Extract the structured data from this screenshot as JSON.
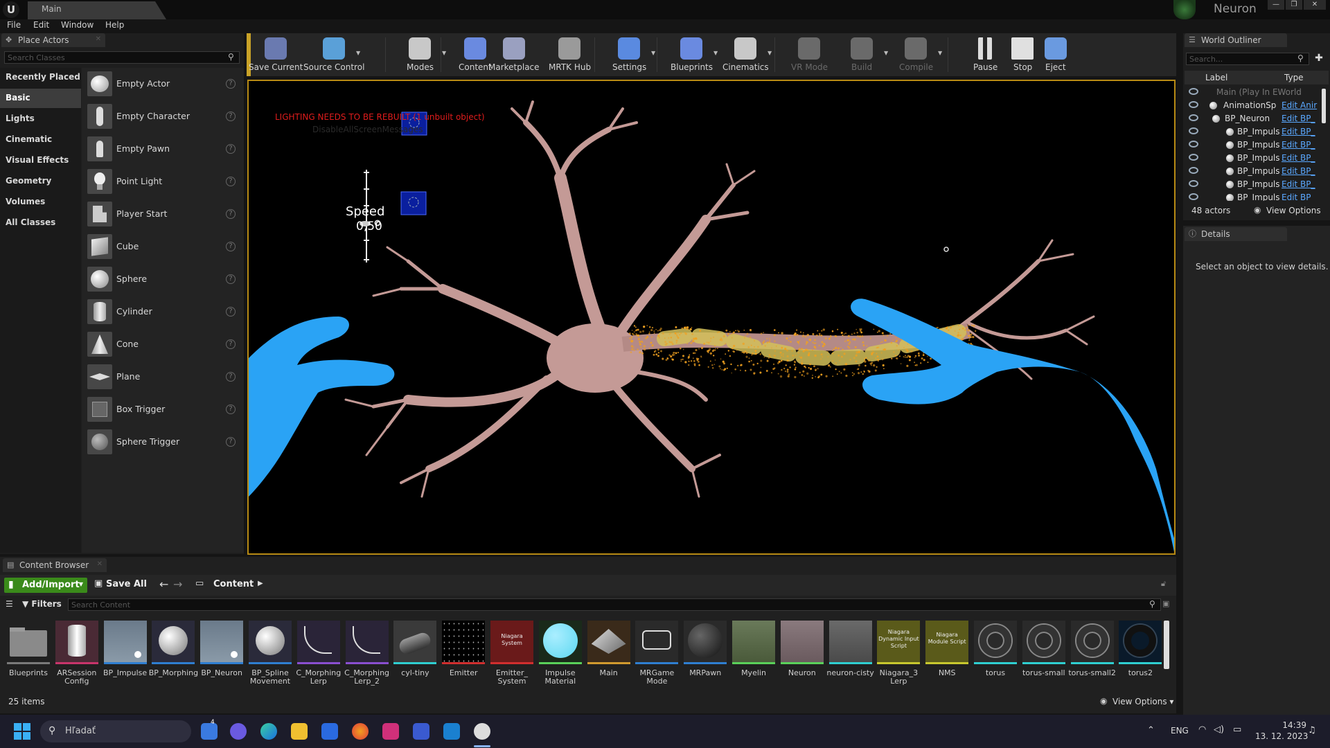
{
  "window": {
    "doc_tab": "Main",
    "project_name": "Neuron"
  },
  "menu": [
    "File",
    "Edit",
    "Window",
    "Help"
  ],
  "place_actors": {
    "tab_title": "Place Actors",
    "search_placeholder": "Search Classes",
    "categories": [
      "Recently Placed",
      "Basic",
      "Lights",
      "Cinematic",
      "Visual Effects",
      "Geometry",
      "Volumes",
      "All Classes"
    ],
    "selected_category": "Basic",
    "actors": [
      "Empty Actor",
      "Empty Character",
      "Empty Pawn",
      "Point Light",
      "Player Start",
      "Cube",
      "Sphere",
      "Cylinder",
      "Cone",
      "Plane",
      "Box Trigger",
      "Sphere Trigger"
    ]
  },
  "toolbar": {
    "buttons": [
      {
        "label": "Save Current",
        "icon": "save-icon"
      },
      {
        "label": "Source Control",
        "icon": "source-control-icon"
      },
      {
        "label": "Modes",
        "icon": "modes-icon"
      },
      {
        "label": "Content",
        "icon": "content-icon"
      },
      {
        "label": "Marketplace",
        "icon": "marketplace-icon"
      },
      {
        "label": "MRTK Hub",
        "icon": "mrtk-hub-icon"
      },
      {
        "label": "Settings",
        "icon": "settings-icon"
      },
      {
        "label": "Blueprints",
        "icon": "blueprints-icon"
      },
      {
        "label": "Cinematics",
        "icon": "cinematics-icon"
      },
      {
        "label": "VR Mode",
        "icon": "vr-mode-icon"
      },
      {
        "label": "Build",
        "icon": "build-icon"
      },
      {
        "label": "Compile",
        "icon": "compile-icon"
      },
      {
        "label": "Pause",
        "icon": "pause-icon"
      },
      {
        "label": "Stop",
        "icon": "stop-icon"
      },
      {
        "label": "Eject",
        "icon": "eject-icon"
      }
    ]
  },
  "viewport": {
    "warning": "LIGHTING NEEDS TO BE REBUILT (1 unbuilt object)",
    "warning_sub": "DisableAllScreenMessages",
    "speed_label": "Speed",
    "speed_value": "0,50"
  },
  "world_outliner": {
    "tab_title": "World Outliner",
    "search_placeholder": "Search...",
    "col_label": "Label",
    "col_type": "Type",
    "rows": [
      {
        "label": "Main (Play In EWorld",
        "type": ""
      },
      {
        "label": "AnimationSp",
        "type": "Edit Anir"
      },
      {
        "label": "BP_Neuron",
        "type": "Edit BP_"
      },
      {
        "label": "BP_Impuls",
        "type": "Edit BP_"
      },
      {
        "label": "BP_Impuls",
        "type": "Edit BP_"
      },
      {
        "label": "BP_Impuls",
        "type": "Edit BP_"
      },
      {
        "label": "BP_Impuls",
        "type": "Edit BP_"
      },
      {
        "label": "BP_Impuls",
        "type": "Edit BP_"
      },
      {
        "label": "BP_Impuls",
        "type": "Edit BP_"
      }
    ],
    "actor_count": "48 actors",
    "view_options": "View Options"
  },
  "details": {
    "tab_title": "Details",
    "empty_message": "Select an object to view details."
  },
  "content_browser": {
    "tab_title": "Content Browser",
    "add_import": "Add/Import",
    "save_all": "Save All",
    "path": "Content",
    "filters": "Filters",
    "search_placeholder": "Search Content",
    "item_count": "25 items",
    "view_options": "View Options",
    "assets": [
      {
        "name": "Blueprints",
        "kind": "folder",
        "color": "#7a7a7a"
      },
      {
        "name": "ARSession Config",
        "kind": "config",
        "color": "#c8356b"
      },
      {
        "name": "BP_Impulse",
        "kind": "bp",
        "color": "#2f7fd1"
      },
      {
        "name": "BP_Morphing",
        "kind": "bp-sphere",
        "color": "#2f7fd1"
      },
      {
        "name": "BP_Neuron",
        "kind": "bp",
        "color": "#2f7fd1"
      },
      {
        "name": "BP_Spline Movement",
        "kind": "bp-sphere",
        "color": "#2f7fd1"
      },
      {
        "name": "C_Morphing Lerp",
        "kind": "curve",
        "color": "#8a4fd1"
      },
      {
        "name": "C_Morphing Lerp_2",
        "kind": "curve",
        "color": "#8a4fd1"
      },
      {
        "name": "cyl-tiny",
        "kind": "mesh",
        "color": "#2fcfd1"
      },
      {
        "name": "Emitter",
        "kind": "particles",
        "color": "#d12f2f"
      },
      {
        "name": "Emitter_ System",
        "kind": "niagara",
        "color": "#d12f2f"
      },
      {
        "name": "Impulse Material",
        "kind": "material",
        "color": "#5ad15a"
      },
      {
        "name": "Main",
        "kind": "level",
        "color": "#d19a2f"
      },
      {
        "name": "MRGame Mode",
        "kind": "gamemode",
        "color": "#2f7fd1"
      },
      {
        "name": "MRPawn",
        "kind": "pawn",
        "color": "#2f7fd1"
      },
      {
        "name": "Myelin",
        "kind": "mat-green",
        "color": "#5ad15a"
      },
      {
        "name": "Neuron",
        "kind": "mat-pink",
        "color": "#5ad15a"
      },
      {
        "name": "neuron-cisty",
        "kind": "mesh-grey",
        "color": "#2fcfd1"
      },
      {
        "name": "Niagara_3 Lerp",
        "kind": "niagara-script",
        "color": "#c8c82f"
      },
      {
        "name": "NMS",
        "kind": "niagara-module",
        "color": "#c8c82f"
      },
      {
        "name": "torus",
        "kind": "torus",
        "color": "#2fcfd1"
      },
      {
        "name": "torus-small",
        "kind": "torus",
        "color": "#2fcfd1"
      },
      {
        "name": "torus-small2",
        "kind": "torus",
        "color": "#2fcfd1"
      },
      {
        "name": "torus2",
        "kind": "torus-dark",
        "color": "#2fcfd1"
      }
    ],
    "niagara_system_label": "Niagara System",
    "niagara_script_label": "Niagara Dynamic Input Script",
    "niagara_module_label": "Niagara Module Script"
  },
  "taskbar": {
    "search_placeholder": "Hľadať",
    "language": "ENG",
    "time": "14:39",
    "date": "13. 12. 2023",
    "badge_count": "4"
  },
  "colors": {
    "viewport_border": "#b78a14",
    "warning": "#e01c1c",
    "hand": "#2aa3f5",
    "neuron": "#c49a96",
    "add_button": "#3a8a1a"
  }
}
